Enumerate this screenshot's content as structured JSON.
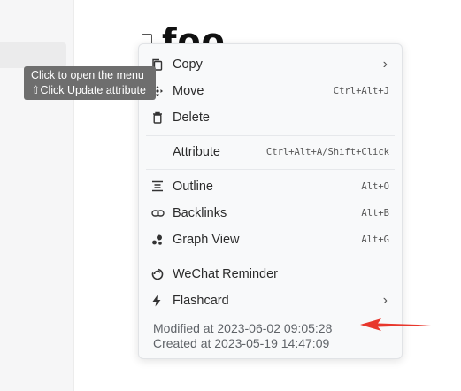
{
  "document": {
    "title": "foo"
  },
  "tooltip": {
    "line1": "Click to open the menu",
    "line2": "⇧Click Update attribute"
  },
  "menu": {
    "items": [
      {
        "label": "Copy",
        "icon": "copy-icon",
        "has_submenu": true
      },
      {
        "label": "Move",
        "icon": "move-icon",
        "shortcut": "Ctrl+Alt+J"
      },
      {
        "label": "Delete",
        "icon": "trash-icon"
      },
      {
        "label": "Attribute",
        "shortcut": "Ctrl+Alt+A/Shift+Click"
      },
      {
        "label": "Outline",
        "icon": "outline-icon",
        "shortcut": "Alt+O"
      },
      {
        "label": "Backlinks",
        "icon": "link-icon",
        "shortcut": "Alt+B"
      },
      {
        "label": "Graph View",
        "icon": "graph-icon",
        "shortcut": "Alt+G"
      },
      {
        "label": "WeChat Reminder",
        "icon": "wechat-icon"
      },
      {
        "label": "Flashcard",
        "icon": "bolt-icon",
        "has_submenu": true
      }
    ],
    "submenu_arrow": "›",
    "modified": "Modified at 2023-06-02 09:05:28",
    "created": "Created at 2023-05-19 14:47:09"
  },
  "colors": {
    "annotation_arrow": "#e8372c",
    "tooltip_bg": "#6e6e6e"
  }
}
